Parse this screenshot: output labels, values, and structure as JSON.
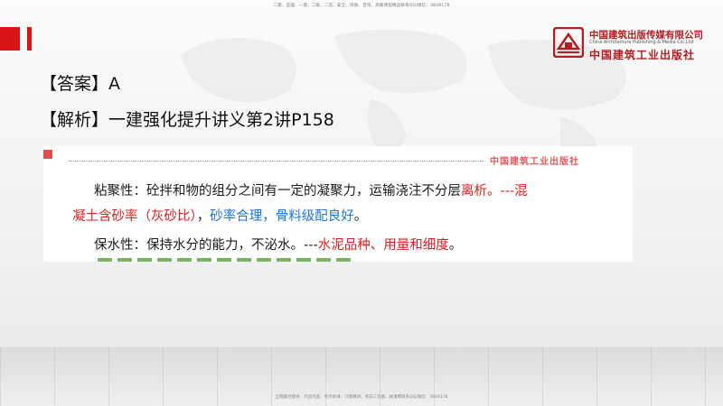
{
  "header_note": "二建、监理、一建、二级、二造、安全、消防、咨询、高端课程精品联系QQ/微信：3849178",
  "footer_note": "全网最佳辅导、内含内容、考点串讲、习题精讲、考前三页纸、故请聘联系QQ/微信：3849178",
  "logo": {
    "cn_name": "中国建筑出版传媒有限公司",
    "en_name": "China Architecture Publishing & Media Co.,Ltd",
    "calligraphy": "中国建筑工业出版社"
  },
  "answer": "【答案】A",
  "analysis": "【解析】一建强化提升讲义第2讲P158",
  "excerpt": {
    "header_logo": "中国建筑工业出版社",
    "line1_a": "粘聚性：砼拌和物的组分之间有一定的凝聚力，运输浇注不分层",
    "line1_red": "离析。---混",
    "line2_red": "凝土含砂率（灰砂比）",
    "line2_sep": "，",
    "line2_blue": "砂率合理，骨料级配良好",
    "line2_end": "。",
    "line3_a": "保水性：保持水分的能力，不泌水。---",
    "line3_red": "水泥品种、用量和细度",
    "line3_end": "。"
  },
  "colors": {
    "brand_red": "#d9151a",
    "text_red": "#e02020",
    "text_blue": "#1d73d6"
  }
}
